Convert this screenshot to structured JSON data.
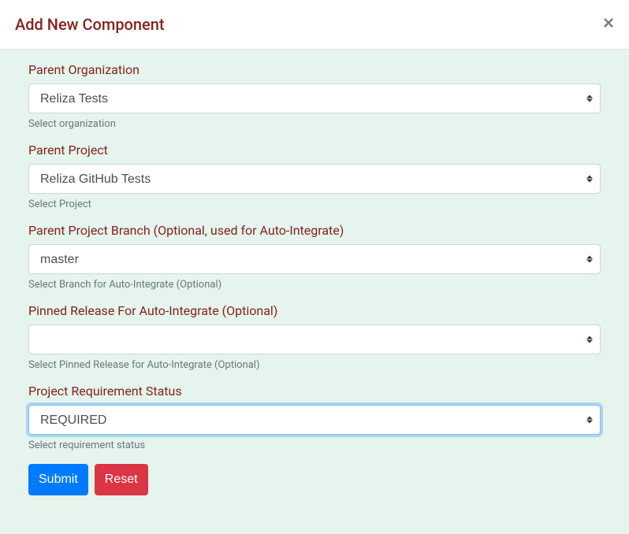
{
  "modal": {
    "title": "Add New Component"
  },
  "fields": {
    "parent_org": {
      "label": "Parent Organization",
      "value": "Reliza Tests",
      "help": "Select organization"
    },
    "parent_project": {
      "label": "Parent Project",
      "value": "Reliza GitHub Tests",
      "help": "Select Project"
    },
    "branch": {
      "label": "Parent Project Branch (Optional, used for Auto-Integrate)",
      "value": "master",
      "help": "Select Branch for Auto-Integrate (Optional)"
    },
    "pinned_release": {
      "label": "Pinned Release For Auto-Integrate (Optional)",
      "value": "",
      "help": "Select Pinned Release for Auto-Integrate (Optional)"
    },
    "req_status": {
      "label": "Project Requirement Status",
      "value": "REQUIRED",
      "help": "Select requirement status"
    }
  },
  "buttons": {
    "submit": "Submit",
    "reset": "Reset"
  }
}
